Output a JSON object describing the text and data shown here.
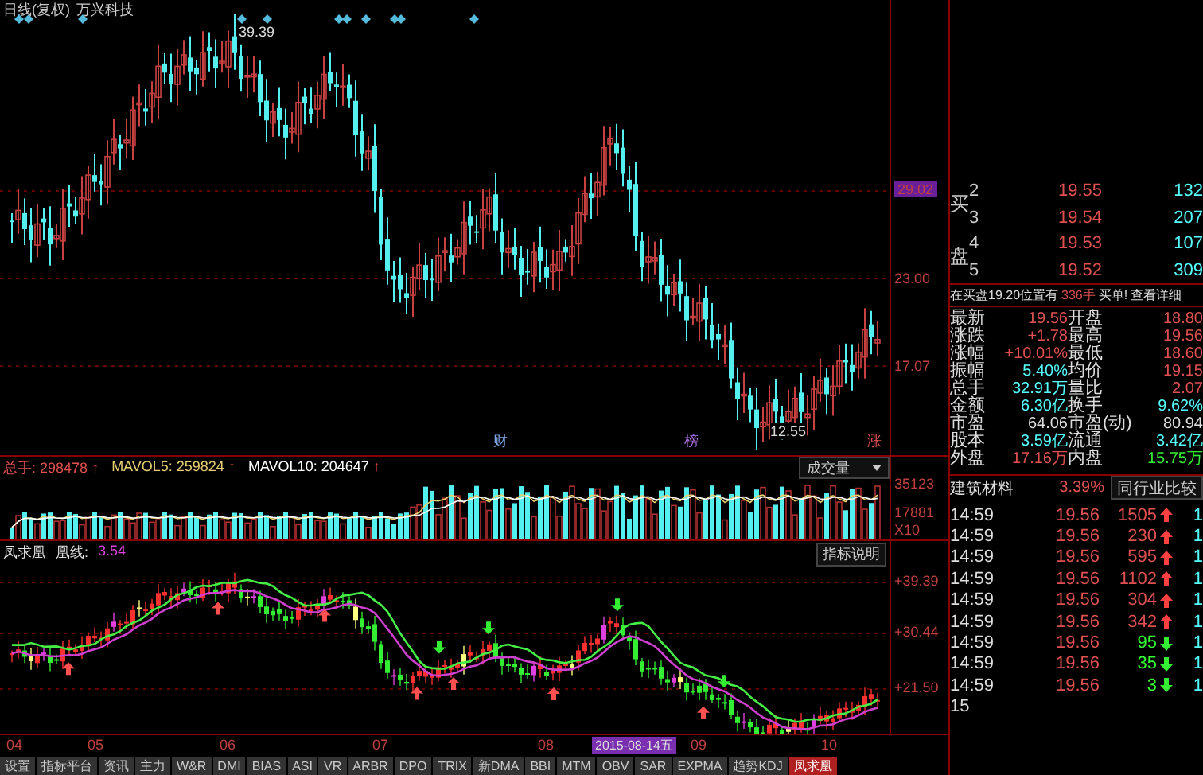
{
  "chart_header": {
    "title": "日线(复权)",
    "stock": "万兴科技"
  },
  "price_chart": {
    "axis_labels": [
      {
        "text": "29.02",
        "highlighted": true
      },
      {
        "text": "23.00",
        "highlighted": false
      },
      {
        "text": "17.07",
        "highlighted": false
      }
    ],
    "high_label": "39.39",
    "low_label": "12.55",
    "event_marks": [
      {
        "text": "财",
        "color": "#7fa8e8"
      },
      {
        "text": "榜",
        "color": "#b070e0"
      },
      {
        "text": "涨",
        "color": "#e05050"
      }
    ]
  },
  "volume": {
    "legend": [
      {
        "text": "总手: 298478",
        "arrow": "↑",
        "color": "#e05050"
      },
      {
        "text": "MAVOL5: 259824",
        "arrow": "↑",
        "color": "#e8d070"
      },
      {
        "text": "MAVOL10: 204647",
        "arrow": "↑",
        "color": "#ffffff"
      }
    ],
    "selector": "成交量",
    "axis_labels": [
      "35123",
      "17881",
      "X10"
    ]
  },
  "indicator": {
    "name": "凤求凰",
    "line_label": "凰线:",
    "value": "3.54",
    "button": "指标说明",
    "axis_labels": [
      "+39.39",
      "+30.44",
      "+21.50"
    ]
  },
  "dates": [
    {
      "text": "04",
      "selected": false
    },
    {
      "text": "05",
      "selected": false
    },
    {
      "text": "06",
      "selected": false
    },
    {
      "text": "07",
      "selected": false
    },
    {
      "text": "08",
      "selected": false
    },
    {
      "text": "2015-08-14五",
      "selected": true
    },
    {
      "text": "09",
      "selected": false
    },
    {
      "text": "10",
      "selected": false
    }
  ],
  "tabs": [
    {
      "label": "设置",
      "selected": false
    },
    {
      "label": "指标平台",
      "selected": false
    },
    {
      "label": "资讯",
      "selected": false
    },
    {
      "label": "主力",
      "selected": false
    },
    {
      "label": "W&R",
      "selected": false
    },
    {
      "label": "DMI",
      "selected": false
    },
    {
      "label": "BIAS",
      "selected": false
    },
    {
      "label": "ASI",
      "selected": false
    },
    {
      "label": "VR",
      "selected": false
    },
    {
      "label": "ARBR",
      "selected": false
    },
    {
      "label": "DPO",
      "selected": false
    },
    {
      "label": "TRIX",
      "selected": false
    },
    {
      "label": "新DMA",
      "selected": false
    },
    {
      "label": "BBI",
      "selected": false
    },
    {
      "label": "MTM",
      "selected": false
    },
    {
      "label": "OBV",
      "selected": false
    },
    {
      "label": "SAR",
      "selected": false
    },
    {
      "label": "EXPMA",
      "selected": false
    },
    {
      "label": "趋势KDJ",
      "selected": false
    },
    {
      "label": "凤求凰",
      "selected": true
    }
  ],
  "order_book": {
    "side_labels": [
      "买",
      "盘"
    ],
    "rows": [
      {
        "rank": "2",
        "price": "19.55",
        "volume": "132"
      },
      {
        "rank": "3",
        "price": "19.54",
        "volume": "207"
      },
      {
        "rank": "4",
        "price": "19.53",
        "volume": "107"
      },
      {
        "rank": "5",
        "price": "19.52",
        "volume": "309"
      }
    ]
  },
  "notice": {
    "text": "在买盘19.20位置有",
    "quantity": "336手",
    "alert": "买单!",
    "link": "查看详细"
  },
  "stats": [
    {
      "cells": [
        {
          "label": "最新",
          "value": "19.56",
          "color": "#e05050"
        },
        {
          "label": "开盘",
          "value": "18.80",
          "color": "#e05050"
        }
      ]
    },
    {
      "cells": [
        {
          "label": "涨跌",
          "value": "+1.78",
          "color": "#e05050"
        },
        {
          "label": "最高",
          "value": "19.56",
          "color": "#e05050"
        }
      ]
    },
    {
      "cells": [
        {
          "label": "涨幅",
          "value": "+10.01%",
          "color": "#e05050"
        },
        {
          "label": "最低",
          "value": "18.60",
          "color": "#e05050"
        }
      ]
    },
    {
      "cells": [
        {
          "label": "振幅",
          "value": "5.40%",
          "color": "#55ffff"
        },
        {
          "label": "均价",
          "value": "19.15",
          "color": "#e05050"
        }
      ]
    },
    {
      "cells": [
        {
          "label": "总手",
          "value": "32.91万",
          "color": "#55ffff"
        },
        {
          "label": "量比",
          "value": "2.07",
          "color": "#e05050"
        }
      ]
    },
    {
      "cells": [
        {
          "label": "金额",
          "value": "6.30亿",
          "color": "#55ffff"
        },
        {
          "label": "换手",
          "value": "9.62%",
          "color": "#55ffff"
        }
      ]
    },
    {
      "cells": [
        {
          "label": "市盈",
          "value": "64.06",
          "color": "#dddddd"
        },
        {
          "label": "市盈(动)",
          "value": "80.94",
          "color": "#dddddd"
        }
      ]
    },
    {
      "cells": [
        {
          "label": "股本",
          "value": "3.59亿",
          "color": "#55ffff"
        },
        {
          "label": "流通",
          "value": "3.42亿",
          "color": "#55ffff"
        }
      ]
    },
    {
      "cells": [
        {
          "label": "外盘",
          "value": "17.16万",
          "color": "#e05050"
        },
        {
          "label": "内盘",
          "value": "15.75万",
          "color": "#33ee33"
        }
      ]
    }
  ],
  "industry": {
    "name": "建筑材料",
    "change": "3.39%",
    "button": "同行业比较"
  },
  "trades": [
    {
      "time": "14:59",
      "price": "19.56",
      "volume": "1505",
      "kind": "buy",
      "column_5": "1"
    },
    {
      "time": "14:59",
      "price": "19.56",
      "volume": "230",
      "kind": "buy",
      "column_5": "1"
    },
    {
      "time": "14:59",
      "price": "19.56",
      "volume": "595",
      "kind": "buy",
      "column_5": "1"
    },
    {
      "time": "14:59",
      "price": "19.56",
      "volume": "1102",
      "kind": "buy",
      "column_5": "1"
    },
    {
      "time": "14:59",
      "price": "19.56",
      "volume": "304",
      "kind": "buy",
      "column_5": "1"
    },
    {
      "time": "14:59",
      "price": "19.56",
      "volume": "342",
      "kind": "buy",
      "column_5": "1"
    },
    {
      "time": "14:59",
      "price": "19.56",
      "volume": "95",
      "kind": "sell",
      "column_5": "1"
    },
    {
      "time": "14:59",
      "price": "19.56",
      "volume": "35",
      "kind": "sell",
      "column_5": "1"
    },
    {
      "time": "14:59",
      "price": "19.56",
      "volume": "3",
      "kind": "sell",
      "column_5": "1"
    }
  ],
  "trades_footer": "15"
}
